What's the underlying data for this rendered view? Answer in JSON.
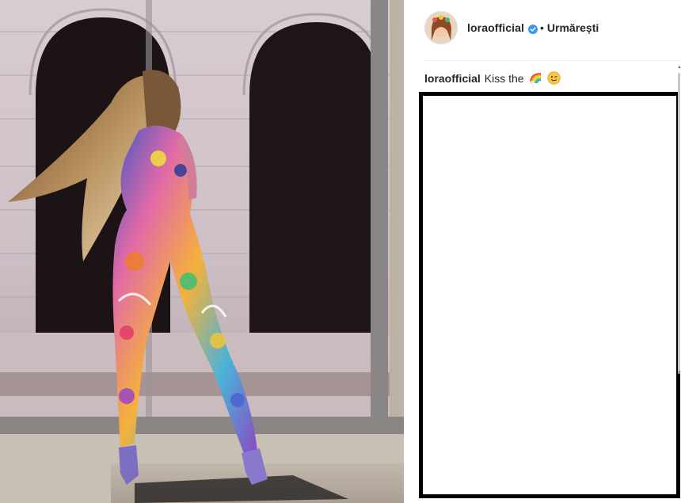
{
  "post": {
    "username": "loraofficial",
    "separator": "•",
    "follow_label": "Urmărești",
    "caption_user": "loraofficial",
    "caption_text": "Kiss the",
    "caption_emojis": [
      "rainbow-emoji",
      "winking-face-emoji"
    ],
    "verified_badge": "verified-icon"
  },
  "colors": {
    "text": "#262626",
    "verified": "#3897f0",
    "divider": "#efefef",
    "frame": "#000000"
  }
}
